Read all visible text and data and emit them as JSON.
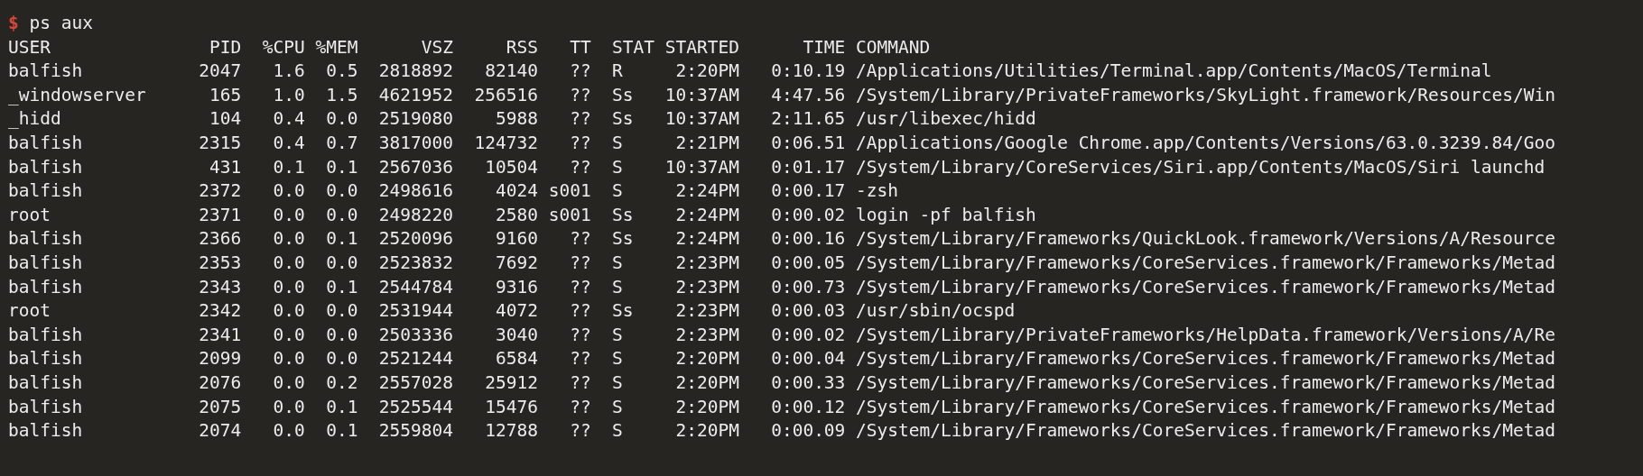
{
  "prompt": {
    "symbol": "$",
    "command": "ps aux"
  },
  "columns": [
    "USER",
    "PID",
    "%CPU",
    "%MEM",
    "VSZ",
    "RSS",
    "TT",
    "STAT",
    "STARTED",
    "TIME",
    "COMMAND"
  ],
  "rows": [
    [
      "balfish",
      "2047",
      "1.6",
      "0.5",
      "2818892",
      "82140",
      "??",
      "R",
      "2:20PM",
      "0:10.19",
      "/Applications/Utilities/Terminal.app/Contents/MacOS/Terminal"
    ],
    [
      "_windowserver",
      "165",
      "1.0",
      "1.5",
      "4621952",
      "256516",
      "??",
      "Ss",
      "10:37AM",
      "4:47.56",
      "/System/Library/PrivateFrameworks/SkyLight.framework/Resources/Win"
    ],
    [
      "_hidd",
      "104",
      "0.4",
      "0.0",
      "2519080",
      "5988",
      "??",
      "Ss",
      "10:37AM",
      "2:11.65",
      "/usr/libexec/hidd"
    ],
    [
      "balfish",
      "2315",
      "0.4",
      "0.7",
      "3817000",
      "124732",
      "??",
      "S",
      "2:21PM",
      "0:06.51",
      "/Applications/Google Chrome.app/Contents/Versions/63.0.3239.84/Goo"
    ],
    [
      "balfish",
      "431",
      "0.1",
      "0.1",
      "2567036",
      "10504",
      "??",
      "S",
      "10:37AM",
      "0:01.17",
      "/System/Library/CoreServices/Siri.app/Contents/MacOS/Siri launchd"
    ],
    [
      "balfish",
      "2372",
      "0.0",
      "0.0",
      "2498616",
      "4024",
      "s001",
      "S",
      "2:24PM",
      "0:00.17",
      "-zsh"
    ],
    [
      "root",
      "2371",
      "0.0",
      "0.0",
      "2498220",
      "2580",
      "s001",
      "Ss",
      "2:24PM",
      "0:00.02",
      "login -pf balfish"
    ],
    [
      "balfish",
      "2366",
      "0.0",
      "0.1",
      "2520096",
      "9160",
      "??",
      "Ss",
      "2:24PM",
      "0:00.16",
      "/System/Library/Frameworks/QuickLook.framework/Versions/A/Resource"
    ],
    [
      "balfish",
      "2353",
      "0.0",
      "0.0",
      "2523832",
      "7692",
      "??",
      "S",
      "2:23PM",
      "0:00.05",
      "/System/Library/Frameworks/CoreServices.framework/Frameworks/Metad"
    ],
    [
      "balfish",
      "2343",
      "0.0",
      "0.1",
      "2544784",
      "9316",
      "??",
      "S",
      "2:23PM",
      "0:00.73",
      "/System/Library/Frameworks/CoreServices.framework/Frameworks/Metad"
    ],
    [
      "root",
      "2342",
      "0.0",
      "0.0",
      "2531944",
      "4072",
      "??",
      "Ss",
      "2:23PM",
      "0:00.03",
      "/usr/sbin/ocspd"
    ],
    [
      "balfish",
      "2341",
      "0.0",
      "0.0",
      "2503336",
      "3040",
      "??",
      "S",
      "2:23PM",
      "0:00.02",
      "/System/Library/PrivateFrameworks/HelpData.framework/Versions/A/Re"
    ],
    [
      "balfish",
      "2099",
      "0.0",
      "0.0",
      "2521244",
      "6584",
      "??",
      "S",
      "2:20PM",
      "0:00.04",
      "/System/Library/Frameworks/CoreServices.framework/Frameworks/Metad"
    ],
    [
      "balfish",
      "2076",
      "0.0",
      "0.2",
      "2557028",
      "25912",
      "??",
      "S",
      "2:20PM",
      "0:00.33",
      "/System/Library/Frameworks/CoreServices.framework/Frameworks/Metad"
    ],
    [
      "balfish",
      "2075",
      "0.0",
      "0.1",
      "2525544",
      "15476",
      "??",
      "S",
      "2:20PM",
      "0:00.12",
      "/System/Library/Frameworks/CoreServices.framework/Frameworks/Metad"
    ],
    [
      "balfish",
      "2074",
      "0.0",
      "0.1",
      "2559804",
      "12788",
      "??",
      "S",
      "2:20PM",
      "0:00.09",
      "/System/Library/Frameworks/CoreServices.framework/Frameworks/Metad"
    ]
  ]
}
